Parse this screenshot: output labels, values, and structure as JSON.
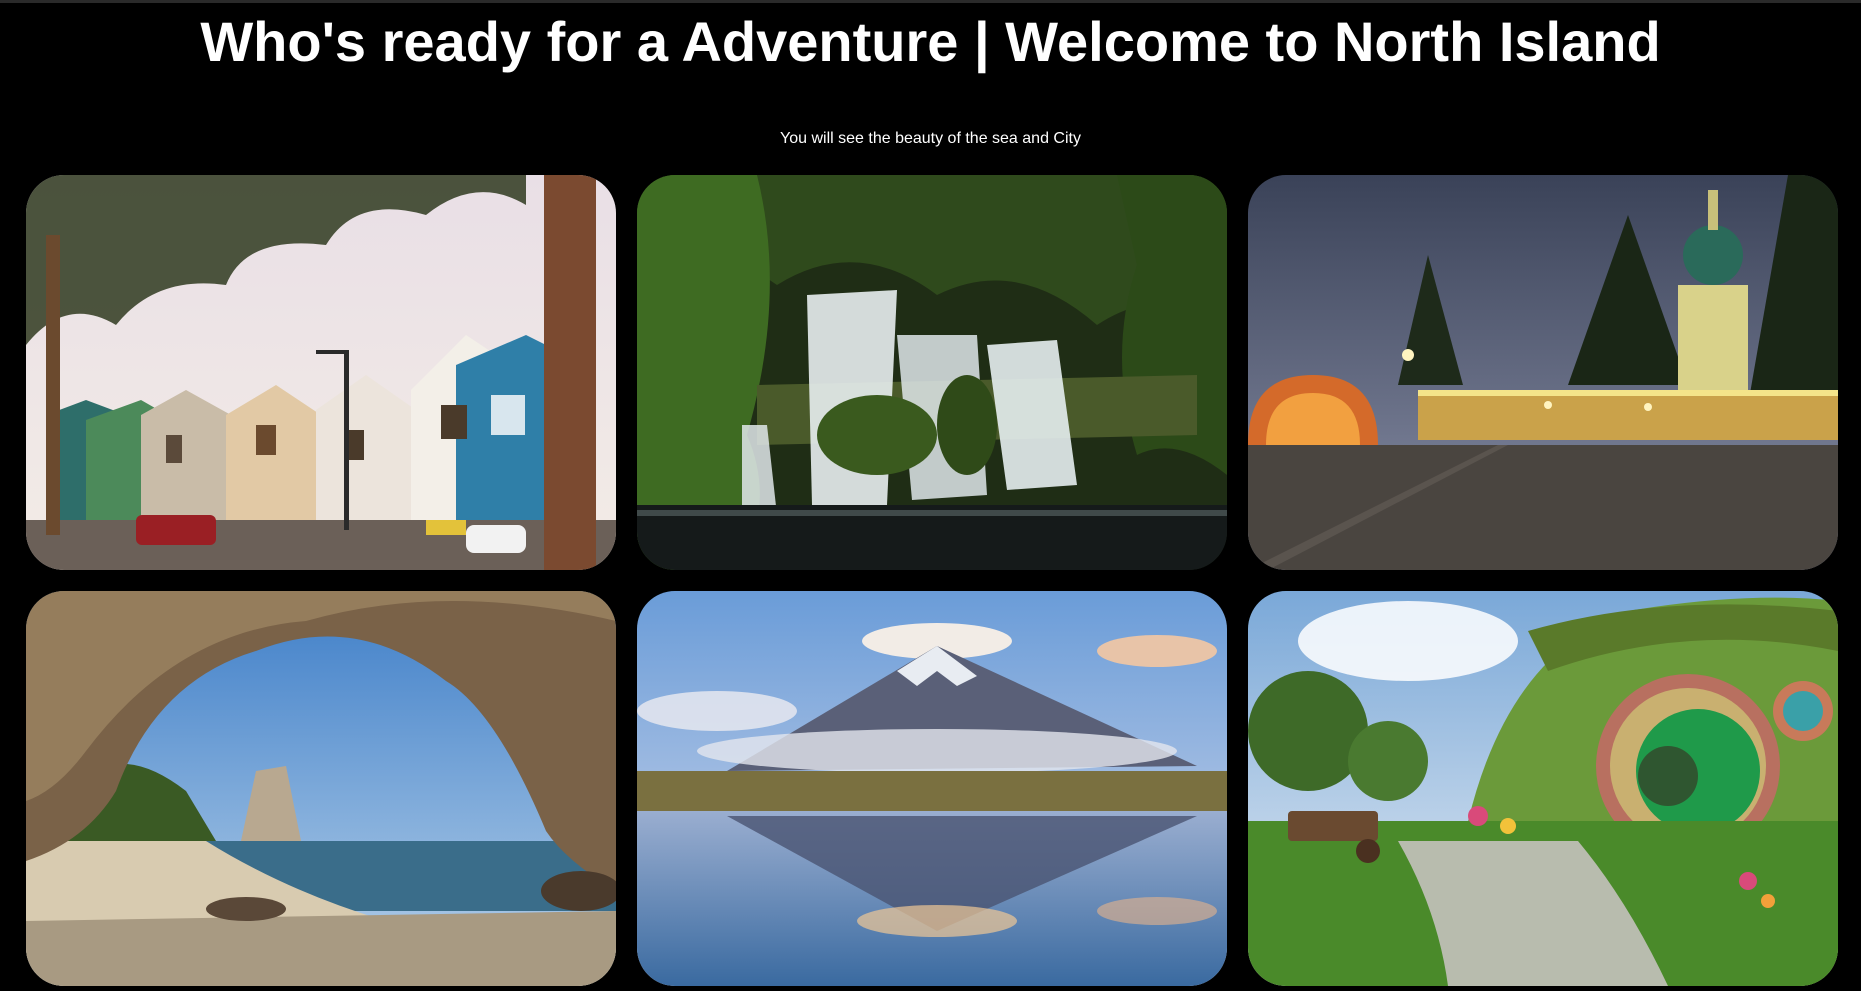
{
  "header": {
    "title": "Who's ready for a Adventure | Welcome to North Island",
    "subtitle": "You will see the beauty of the sea and City"
  },
  "colors": {
    "background": "#000000",
    "text": "#ffffff"
  },
  "gallery": {
    "photos": [
      {
        "subject": "victorian-street-houses"
      },
      {
        "subject": "waterfall"
      },
      {
        "subject": "night-plaza-soundshell"
      },
      {
        "subject": "sea-cave-arch-beach"
      },
      {
        "subject": "mountain-reflection-lake"
      },
      {
        "subject": "hobbit-hole-garden"
      }
    ]
  }
}
